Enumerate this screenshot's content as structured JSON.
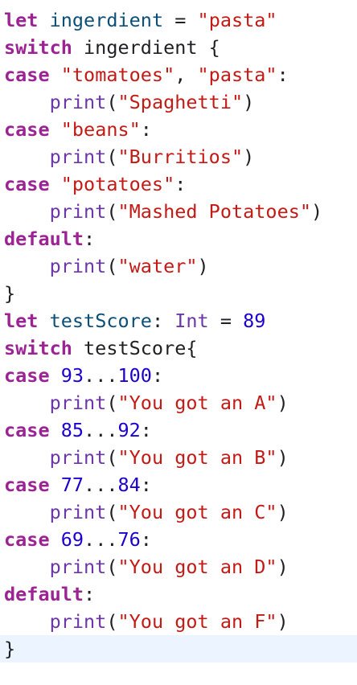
{
  "colors": {
    "keyword": "#9b2393",
    "string": "#c41a16",
    "number": "#1c00cf",
    "identifier": "#0b4f79",
    "function": "#6c36a9",
    "plain": "#1f1f24",
    "background": "#ffffff",
    "current_line": "#ecf5ff"
  },
  "editor": {
    "current_line_index": 23,
    "lines": [
      [
        {
          "t": "let",
          "c": "kw"
        },
        {
          "t": " "
        },
        {
          "t": "ingerdient",
          "c": "ty"
        },
        {
          "t": " = "
        },
        {
          "t": "\"pasta\"",
          "c": "str"
        }
      ],
      [
        {
          "t": "switch",
          "c": "kw"
        },
        {
          "t": " ingerdient {"
        }
      ],
      [
        {
          "t": "case",
          "c": "kw"
        },
        {
          "t": " "
        },
        {
          "t": "\"tomatoes\"",
          "c": "str"
        },
        {
          "t": ", "
        },
        {
          "t": "\"pasta\"",
          "c": "str"
        },
        {
          "t": ":"
        }
      ],
      [
        {
          "t": "    "
        },
        {
          "t": "print",
          "c": "fn"
        },
        {
          "t": "("
        },
        {
          "t": "\"Spaghetti\"",
          "c": "str"
        },
        {
          "t": ")"
        }
      ],
      [
        {
          "t": "case",
          "c": "kw"
        },
        {
          "t": " "
        },
        {
          "t": "\"beans\"",
          "c": "str"
        },
        {
          "t": ":"
        }
      ],
      [
        {
          "t": "    "
        },
        {
          "t": "print",
          "c": "fn"
        },
        {
          "t": "("
        },
        {
          "t": "\"Burritios\"",
          "c": "str"
        },
        {
          "t": ")"
        }
      ],
      [
        {
          "t": "case",
          "c": "kw"
        },
        {
          "t": " "
        },
        {
          "t": "\"potatoes\"",
          "c": "str"
        },
        {
          "t": ":"
        }
      ],
      [
        {
          "t": "    "
        },
        {
          "t": "print",
          "c": "fn"
        },
        {
          "t": "("
        },
        {
          "t": "\"Mashed Potatoes\"",
          "c": "str"
        },
        {
          "t": ")"
        }
      ],
      [
        {
          "t": "default",
          "c": "kw"
        },
        {
          "t": ":"
        }
      ],
      [
        {
          "t": "    "
        },
        {
          "t": "print",
          "c": "fn"
        },
        {
          "t": "("
        },
        {
          "t": "\"water\"",
          "c": "str"
        },
        {
          "t": ")"
        }
      ],
      [
        {
          "t": "}"
        }
      ],
      [
        {
          "t": "let",
          "c": "kw"
        },
        {
          "t": " "
        },
        {
          "t": "testScore",
          "c": "ty"
        },
        {
          "t": ": "
        },
        {
          "t": "Int",
          "c": "fn"
        },
        {
          "t": " = "
        },
        {
          "t": "89",
          "c": "num"
        }
      ],
      [
        {
          "t": "switch",
          "c": "kw"
        },
        {
          "t": " testScore{"
        }
      ],
      [
        {
          "t": "case",
          "c": "kw"
        },
        {
          "t": " "
        },
        {
          "t": "93",
          "c": "num"
        },
        {
          "t": "..."
        },
        {
          "t": "100",
          "c": "num"
        },
        {
          "t": ":"
        }
      ],
      [
        {
          "t": "    "
        },
        {
          "t": "print",
          "c": "fn"
        },
        {
          "t": "("
        },
        {
          "t": "\"You got an A\"",
          "c": "str"
        },
        {
          "t": ")"
        }
      ],
      [
        {
          "t": "case",
          "c": "kw"
        },
        {
          "t": " "
        },
        {
          "t": "85",
          "c": "num"
        },
        {
          "t": "..."
        },
        {
          "t": "92",
          "c": "num"
        },
        {
          "t": ":"
        }
      ],
      [
        {
          "t": "    "
        },
        {
          "t": "print",
          "c": "fn"
        },
        {
          "t": "("
        },
        {
          "t": "\"You got an B\"",
          "c": "str"
        },
        {
          "t": ")"
        }
      ],
      [
        {
          "t": "case",
          "c": "kw"
        },
        {
          "t": " "
        },
        {
          "t": "77",
          "c": "num"
        },
        {
          "t": "..."
        },
        {
          "t": "84",
          "c": "num"
        },
        {
          "t": ":"
        }
      ],
      [
        {
          "t": "    "
        },
        {
          "t": "print",
          "c": "fn"
        },
        {
          "t": "("
        },
        {
          "t": "\"You got an C\"",
          "c": "str"
        },
        {
          "t": ")"
        }
      ],
      [
        {
          "t": "case",
          "c": "kw"
        },
        {
          "t": " "
        },
        {
          "t": "69",
          "c": "num"
        },
        {
          "t": "..."
        },
        {
          "t": "76",
          "c": "num"
        },
        {
          "t": ":"
        }
      ],
      [
        {
          "t": "    "
        },
        {
          "t": "print",
          "c": "fn"
        },
        {
          "t": "("
        },
        {
          "t": "\"You got an D\"",
          "c": "str"
        },
        {
          "t": ")"
        }
      ],
      [
        {
          "t": "default",
          "c": "kw"
        },
        {
          "t": ":"
        }
      ],
      [
        {
          "t": "    "
        },
        {
          "t": "print",
          "c": "fn"
        },
        {
          "t": "("
        },
        {
          "t": "\"You got an F\"",
          "c": "str"
        },
        {
          "t": ")"
        }
      ],
      [
        {
          "t": "}"
        }
      ]
    ]
  }
}
